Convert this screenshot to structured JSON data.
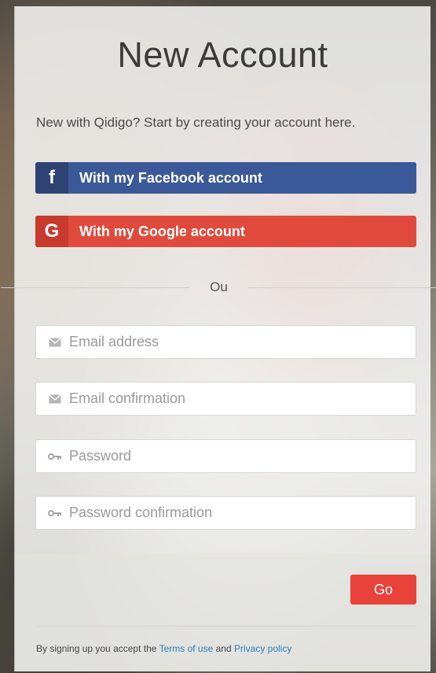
{
  "title": "New Account",
  "subtitle": "New with Qidigo? Start by creating your account here.",
  "social": {
    "facebook": {
      "icon": "f",
      "label": "With my Facebook account",
      "color": "#3b5998"
    },
    "google": {
      "icon": "G",
      "label": "With my Google account",
      "color": "#e04a3d"
    }
  },
  "divider_text": "Ou",
  "fields": {
    "email": {
      "placeholder": "Email address",
      "icon": "envelope-icon"
    },
    "email_confirm": {
      "placeholder": "Email confirmation",
      "icon": "envelope-icon"
    },
    "password": {
      "placeholder": "Password",
      "icon": "key-icon"
    },
    "password_confirm": {
      "placeholder": "Password confirmation",
      "icon": "key-icon"
    }
  },
  "submit_label": "Go",
  "terms": {
    "prefix": "By signing up you accept the",
    "terms_link": "Terms of use",
    "and": "and",
    "privacy_link": "Privacy policy"
  }
}
